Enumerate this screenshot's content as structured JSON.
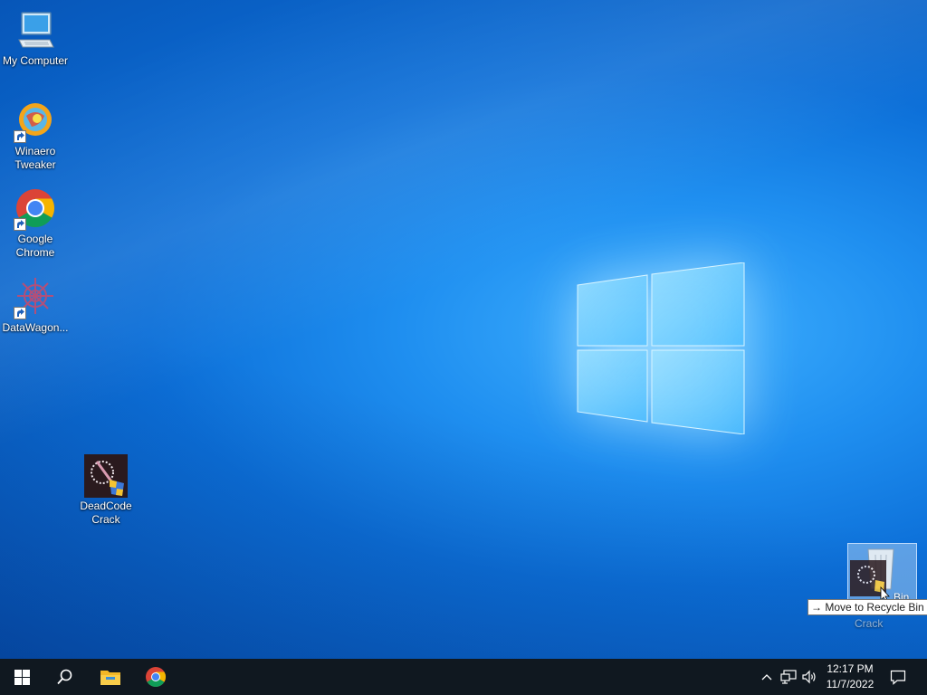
{
  "desktop": {
    "icons": [
      {
        "label": "My Computer",
        "icon": "computer-icon"
      },
      {
        "label": "Winaero Tweaker",
        "icon": "winaero-tweaker-icon"
      },
      {
        "label": "Google Chrome",
        "icon": "chrome-icon"
      },
      {
        "label": "DataWagon...",
        "icon": "datawagon-icon"
      },
      {
        "label": "DeadCode Crack",
        "icon": "deadcode-crack-icon"
      }
    ],
    "drag": {
      "tooltip": "Move to Recycle Bin",
      "target_label": "Bin",
      "ghost_label": "Crack"
    }
  },
  "taskbar": {
    "start_icon": "windows-start-icon",
    "search_icon": "search-icon",
    "pinned": [
      "file-explorer-icon",
      "chrome-icon"
    ],
    "tray": {
      "icons": [
        "chevron-up-icon",
        "network-icon",
        "volume-icon"
      ],
      "time": "12:17 PM",
      "date": "11/7/2022",
      "notification_icon": "notification-icon"
    }
  },
  "colors": {
    "taskbar": "#101820",
    "desktop_accent": "#1f8ff0"
  }
}
